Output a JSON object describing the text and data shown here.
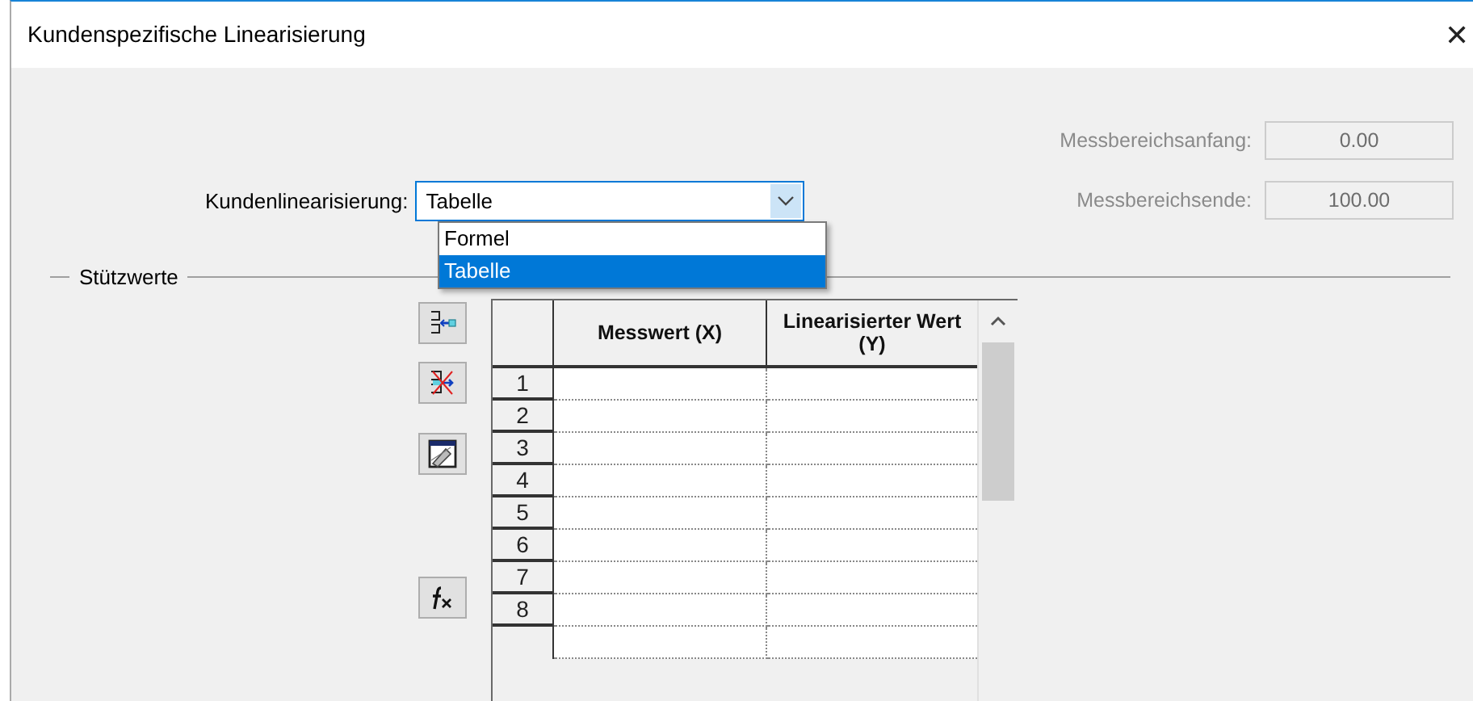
{
  "window": {
    "title": "Kundenspezifische Linearisierung",
    "close": "✕"
  },
  "range_fields": [
    {
      "label": "Messbereichsanfang:",
      "value": "0.00",
      "disabled": true
    },
    {
      "label": "Messbereichsende:",
      "value": "100.00",
      "disabled": true
    }
  ],
  "linearization": {
    "label": "Kundenlinearisierung:",
    "value": "Tabelle",
    "expanded": true,
    "options": [
      {
        "label": "Formel",
        "selected": false
      },
      {
        "label": "Tabelle",
        "selected": true
      }
    ]
  },
  "group": {
    "title": "Stützwerte"
  },
  "tools": [
    {
      "kind": "insert"
    },
    {
      "kind": "delete"
    },
    {
      "kind": "edit"
    },
    {
      "kind": "formula"
    }
  ],
  "table": {
    "columns": [
      "Messwert (X)",
      "Linearisierter Wert (Y)"
    ],
    "rows": [
      {
        "number": "1"
      },
      {
        "number": "2"
      },
      {
        "number": "3"
      },
      {
        "number": "4"
      },
      {
        "number": "5"
      },
      {
        "number": "6"
      },
      {
        "number": "7"
      },
      {
        "number": "8"
      }
    ]
  }
}
